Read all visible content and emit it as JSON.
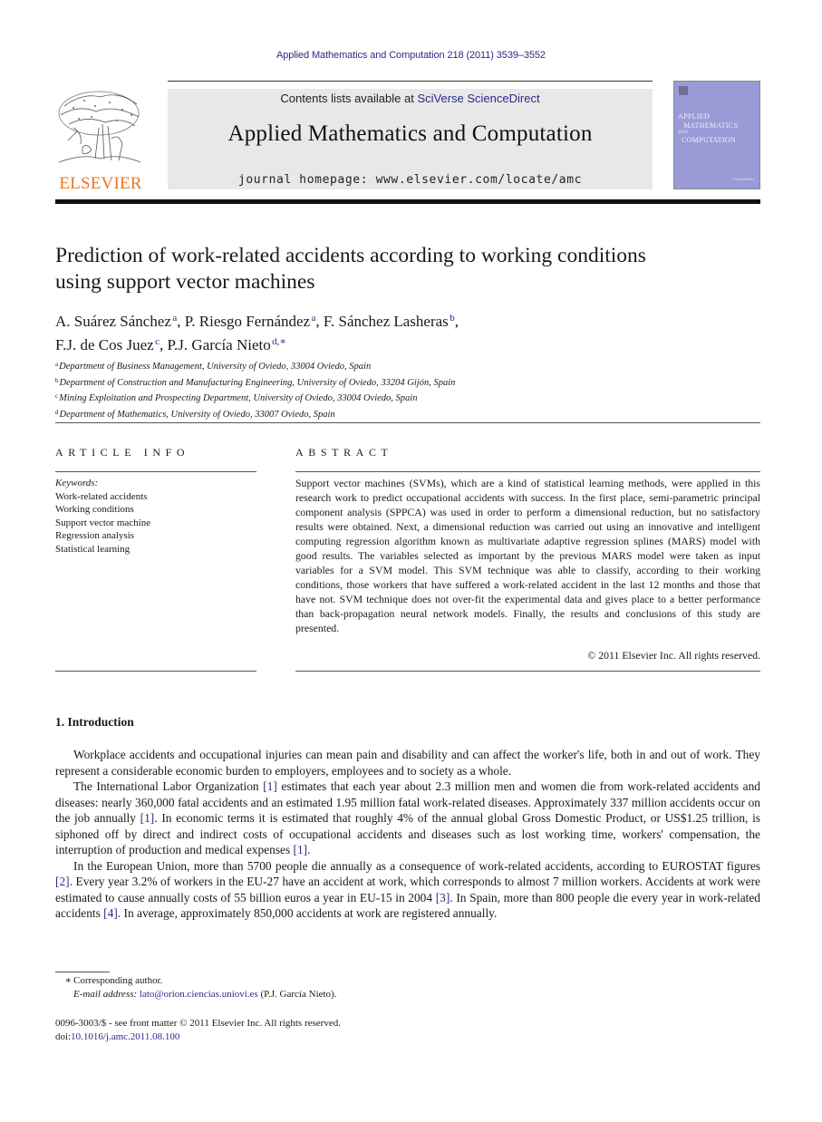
{
  "header": {
    "journal_ref": "Applied Mathematics and Computation 218 (2011) 3539–3552",
    "publisher_logo_text": "ELSEVIER",
    "contents_prefix": "Contents lists available at ",
    "contents_link": "SciVerse ScienceDirect",
    "journal_title": "Applied Mathematics and Computation",
    "homepage": "journal homepage: www.elsevier.com/locate/amc",
    "cover": {
      "line1": "APPLIED",
      "line2": "MATHEMATICS",
      "line3": "AND",
      "line4": "COMPUTATION",
      "color": "#9a9ad6"
    },
    "brand_color": "#e87722",
    "link_color": "#2a2a8a"
  },
  "article": {
    "title_line1": "Prediction of work-related accidents according to working conditions",
    "title_line2": "using support vector machines",
    "authors": [
      {
        "name": "A. Suárez Sánchez",
        "sup": "a",
        "sep": ", "
      },
      {
        "name": "P. Riesgo Fernández",
        "sup": "a",
        "sep": ", "
      },
      {
        "name": "F. Sánchez Lasheras",
        "sup": "b",
        "sep": ","
      },
      {
        "name": "F.J. de Cos Juez",
        "sup": "c",
        "sep": ", "
      },
      {
        "name": "P.J. García Nieto",
        "sup": "d,∗",
        "sep": ""
      }
    ],
    "affiliations": [
      {
        "key": "a",
        "text": "Department of Business Management, University of Oviedo, 33004 Oviedo, Spain"
      },
      {
        "key": "b",
        "text": "Department of Construction and Manufacturing Engineering, University of Oviedo, 33204 Gijón, Spain"
      },
      {
        "key": "c",
        "text": "Mining Exploitation and Prospecting Department, University of Oviedo, 33004 Oviedo, Spain"
      },
      {
        "key": "d",
        "text": "Department of Mathematics, University of Oviedo, 33007 Oviedo, Spain"
      }
    ]
  },
  "article_info": {
    "heading": "ARTICLE INFO",
    "keywords_label": "Keywords:",
    "keywords": [
      "Work-related accidents",
      "Working conditions",
      "Support vector machine",
      "Regression analysis",
      "Statistical learning"
    ]
  },
  "abstract": {
    "heading": "ABSTRACT",
    "text": "Support vector machines (SVMs), which are a kind of statistical learning methods, were applied in this research work to predict occupational accidents with success. In the first place, semi-parametric principal component analysis (SPPCA) was used in order to perform a dimensional reduction, but no satisfactory results were obtained. Next, a dimensional reduction was carried out using an innovative and intelligent computing regression algorithm known as multivariate adaptive regression splines (MARS) model with good results. The variables selected as important by the previous MARS model were taken as input variables for a SVM model. This SVM technique was able to classify, according to their working conditions, those workers that have suffered a work-related accident in the last 12 months and those that have not. SVM technique does not over-fit the experimental data and gives place to a better performance than back-propagation neural network models. Finally, the results and conclusions of this study are presented.",
    "copyright": "© 2011 Elsevier Inc. All rights reserved."
  },
  "introduction": {
    "heading": "1. Introduction",
    "p1": "Workplace accidents and occupational injuries can mean pain and disability and can affect the worker's life, both in and out of work. They represent a considerable economic burden to employers, employees and to society as a whole.",
    "p2_a": "The International Labor Organization ",
    "p2_ref1": "[1]",
    "p2_b": " estimates that each year about 2.3 million men and women die from work-related accidents and diseases: nearly 360,000 fatal accidents and an estimated 1.95 million fatal work-related diseases. Approximately 337 million accidents occur on the job annually ",
    "p2_ref2": "[1]",
    "p2_c": ". In economic terms it is estimated that roughly 4% of the annual global Gross Domestic Product, or US$1.25 trillion, is siphoned off by direct and indirect costs of occupational accidents and diseases such as lost working time, workers' compensation, the interruption of production and medical expenses ",
    "p2_ref3": "[1]",
    "p2_d": ".",
    "p3_a": "In the European Union, more than 5700 people die annually as a consequence of work-related accidents, according to EUROSTAT figures ",
    "p3_ref1": "[2]",
    "p3_b": ". Every year 3.2% of workers in the EU-27 have an accident at work, which corresponds to almost 7 million workers. Accidents at work were estimated to cause annually costs of 55 billion euros a year in EU-15 in 2004 ",
    "p3_ref2": "[3]",
    "p3_c": ". In Spain, more than 800 people die every year in work-related accidents ",
    "p3_ref3": "[4]",
    "p3_d": ". In average, approximately 850,000 accidents at work are registered annually."
  },
  "footnote": {
    "star": "∗",
    "corresponding": "Corresponding author.",
    "email_label": "E-mail address:",
    "email": "lato@orion.ciencias.uniovi.es",
    "email_owner": " (P.J. García Nieto).",
    "issn_line": "0096-3003/$ - see front matter © 2011 Elsevier Inc. All rights reserved.",
    "doi_prefix": "doi:",
    "doi": "10.1016/j.amc.2011.08.100"
  }
}
